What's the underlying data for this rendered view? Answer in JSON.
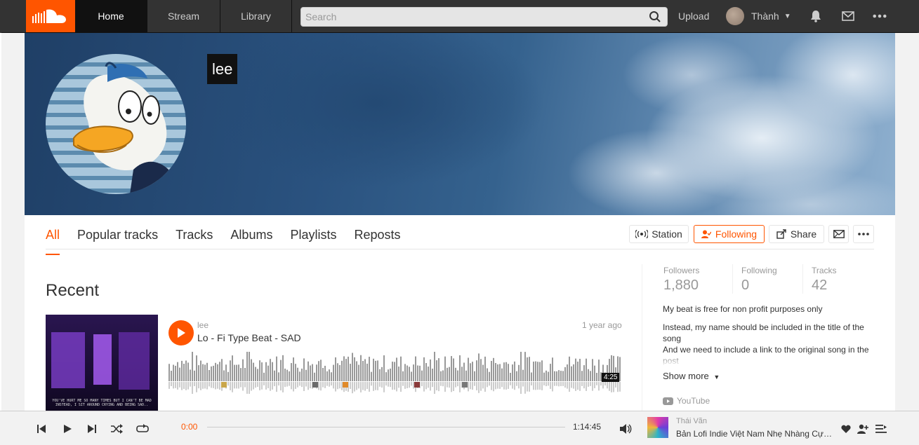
{
  "header": {
    "nav": {
      "home": "Home",
      "stream": "Stream",
      "library": "Library"
    },
    "search_placeholder": "Search",
    "upload": "Upload",
    "user_name": "Thành",
    "accent": "#ff5500"
  },
  "profile": {
    "name": "lee",
    "tabs": [
      "All",
      "Popular tracks",
      "Tracks",
      "Albums",
      "Playlists",
      "Reposts"
    ],
    "active_tab": "All",
    "actions": {
      "station": "Station",
      "following": "Following",
      "share": "Share"
    }
  },
  "recent": {
    "heading": "Recent",
    "track": {
      "user": "lee",
      "title": "Lo - Fi Type Beat - SAD",
      "posted": "1 year ago",
      "duration": "4:25",
      "cover_lyrics": "YOU'VE HURT ME SO MANY TIMES BUT I CAN'T BE MAD INSTEAD, I SIT AROUND CRYING AND BEING SAD.."
    }
  },
  "sidebar": {
    "stats": [
      {
        "label": "Followers",
        "value": "1,880"
      },
      {
        "label": "Following",
        "value": "0"
      },
      {
        "label": "Tracks",
        "value": "42"
      }
    ],
    "bio": [
      "My beat is free for non profit purposes only",
      "Instead, my name should be included in the title of the song",
      "And we need to include a link to the original song in the post"
    ],
    "show_more": "Show more",
    "link": "YouTube"
  },
  "player": {
    "time_current": "0:00",
    "time_total": "1:14:45",
    "now_playing_artist": "Thái Vãn",
    "now_playing_title": "Bản Lofi Indie Việt Nam Nhẹ Nhàng Cực Chill"
  }
}
